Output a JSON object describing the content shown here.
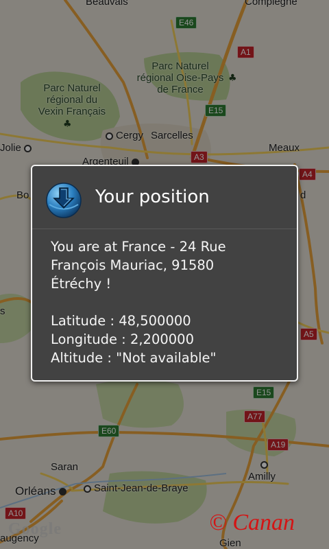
{
  "map": {
    "places": {
      "beauvais": "Beauvais",
      "compiegne": "Compiègne",
      "parc_oise": "Parc Naturel\nrégional Oise-Pays\nde France",
      "parc_vexin": "Parc Naturel\nrégional du\nVexin Français",
      "jolie": "Jolie",
      "cergy": "Cergy",
      "sarcelles": "Sarcelles",
      "meaux": "Meaux",
      "argenteuil": "Argenteuil",
      "bo": "Bo",
      "d": "d",
      "s": "s",
      "saran": "Saran",
      "orleans": "Orléans",
      "saint_jean": "Saint-Jean-de-Braye",
      "amilly": "Amilly",
      "augency": "augency",
      "gien": "Gien"
    },
    "roads": {
      "e46": "E46",
      "a1": "A1",
      "e15_top": "E15",
      "a3": "A3",
      "a4": "A4",
      "a5": "A5",
      "e15_bottom": "E15",
      "a77": "A77",
      "e60": "E60",
      "a19": "A19",
      "a10": "A10"
    },
    "attribution": "Google",
    "watermark": "© Canan"
  },
  "dialog": {
    "title": "Your position",
    "icon": "download-globe-icon",
    "address_line1": "You are at France - 24 Rue",
    "address_line2": "François Mauriac, 91580",
    "address_line3": "Étréchy !",
    "latitude": "Latitude : 48,500000",
    "longitude": "Longitude : 2,200000",
    "altitude": "Altitude : \"Not available\""
  },
  "colors": {
    "dialog_bg": "#424242",
    "dialog_border": "#f2f2f2",
    "road_major": "#e8a23c",
    "shield_red": "#c5232a",
    "shield_green": "#2e7d32",
    "park": "#b9cf97",
    "watermark": "#d41414"
  }
}
